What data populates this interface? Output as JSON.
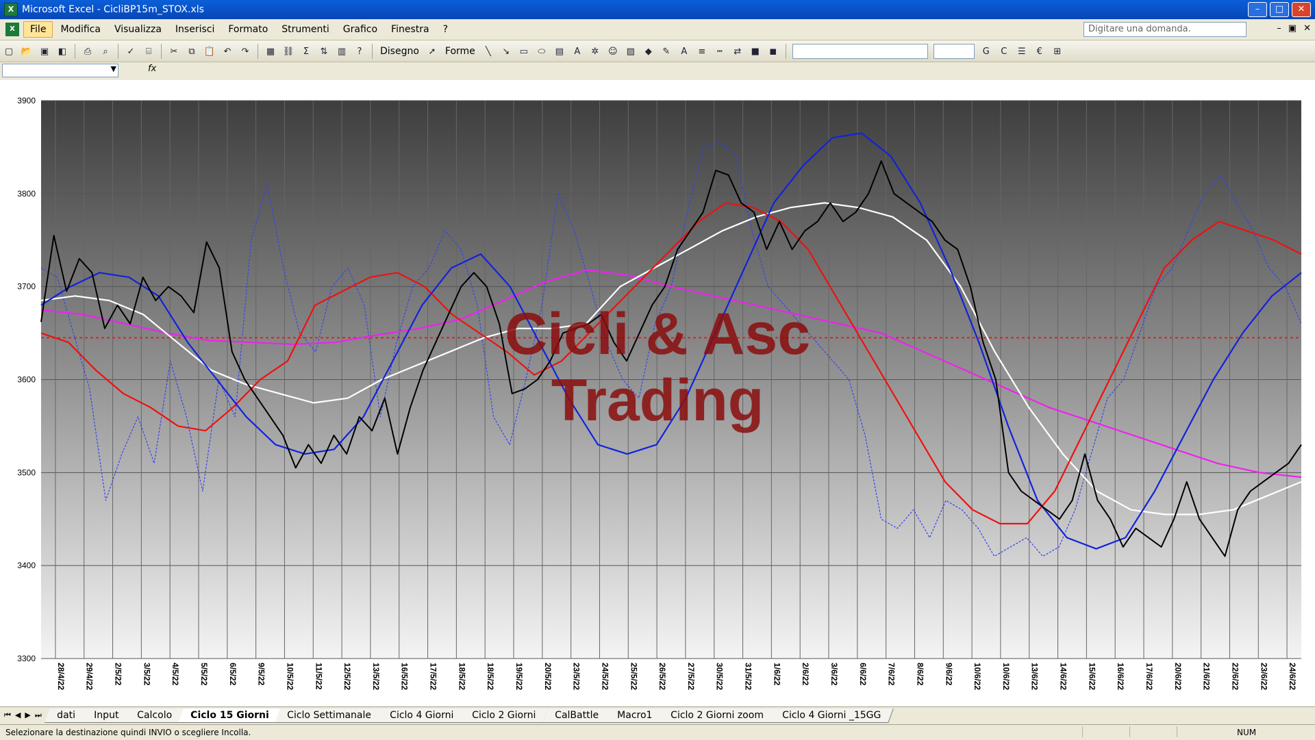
{
  "app": {
    "title": "Microsoft Excel - CicliBP15m_STOX.xls"
  },
  "window_controls": {
    "minimize": "–",
    "maximize": "□",
    "close": "✕"
  },
  "menu": [
    "File",
    "Modifica",
    "Visualizza",
    "Inserisci",
    "Formato",
    "Strumenti",
    "Grafico",
    "Finestra",
    "?"
  ],
  "help_box": {
    "placeholder": "Digitare una domanda."
  },
  "doc_controls": {
    "minimize": "–",
    "restore": "▣",
    "close": "✕"
  },
  "toolbar": {
    "disegno_label": "Disegno",
    "forme_label": "Forme",
    "icons": [
      "new-icon",
      "open-icon",
      "save-icon",
      "permission-icon",
      "print-icon",
      "print-preview-icon",
      "spelling-icon",
      "research-icon",
      "cut-icon",
      "copy-icon",
      "paste-icon",
      "undo-icon",
      "redo-icon",
      "chart-wizard-icon",
      "hyperlink-icon",
      "autosum-icon",
      "sort-icon",
      "chart-icon",
      "help-icon",
      "pointer-icon",
      "line-icon",
      "arrow-icon",
      "rectangle-icon",
      "oval-icon",
      "textbox-icon",
      "wordart-icon",
      "diagram-icon",
      "clipart-icon",
      "picture-icon",
      "fill-color-icon",
      "line-color-icon",
      "font-color-icon",
      "line-style-icon",
      "dash-style-icon",
      "arrow-style-icon",
      "shadow-icon",
      "3d-icon",
      "bold-icon",
      "italic-icon",
      "align-icon",
      "euro-icon",
      "borders-icon"
    ]
  },
  "formula_bar": {
    "fx": "fx"
  },
  "chart_data": {
    "type": "line",
    "ylim": [
      3300,
      3900
    ],
    "yticks": [
      "3900",
      "3800",
      "3700",
      "3600",
      "3500",
      "3400",
      "3300"
    ],
    "reference_line": 3645,
    "watermark": [
      "Cicli & Asc",
      "Trading"
    ],
    "x_labels": [
      "28/4/22",
      "29/4/22",
      "2/5/22",
      "3/5/22",
      "4/5/22",
      "5/5/22",
      "6/5/22",
      "9/5/22",
      "10/5/22",
      "11/5/22",
      "12/5/22",
      "13/5/22",
      "16/5/22",
      "17/5/22",
      "18/5/22",
      "18/5/22",
      "19/5/22",
      "20/5/22",
      "23/5/22",
      "24/5/22",
      "25/5/22",
      "26/5/22",
      "27/5/22",
      "30/5/22",
      "31/5/22",
      "1/6/22",
      "2/6/22",
      "3/6/22",
      "6/6/22",
      "7/6/22",
      "8/6/22",
      "9/6/22",
      "10/6/22",
      "10/6/22",
      "13/6/22",
      "14/6/22",
      "15/6/22",
      "16/6/22",
      "17/6/22",
      "20/6/22",
      "21/6/22",
      "22/6/22",
      "23/6/22",
      "24/6/22"
    ],
    "colors": {
      "price": "#000000",
      "cycle_fast": "#3344ee",
      "red_ma": "#ee1111",
      "blue_ma": "#1122dd",
      "white_ma": "#ffffff",
      "magenta_ma": "#ee22ee",
      "ref": "#dd2222",
      "watermark": "#8b0d0d"
    },
    "series": [
      {
        "key": "price",
        "values": [
          3662,
          3755,
          3695,
          3730,
          3715,
          3655,
          3680,
          3660,
          3710,
          3685,
          3700,
          3690,
          3672,
          3748,
          3720,
          3630,
          3600,
          3580,
          3560,
          3540,
          3505,
          3530,
          3510,
          3540,
          3520,
          3560,
          3545,
          3580,
          3520,
          3570,
          3610,
          3640,
          3670,
          3700,
          3715,
          3700,
          3660,
          3585,
          3590,
          3600,
          3620,
          3650,
          3655,
          3660,
          3670,
          3640,
          3620,
          3650,
          3680,
          3700,
          3740,
          3760,
          3780,
          3825,
          3820,
          3790,
          3780,
          3740,
          3770,
          3740,
          3760,
          3770,
          3790,
          3770,
          3780,
          3800,
          3835,
          3800,
          3790,
          3780,
          3770,
          3750,
          3740,
          3700,
          3640,
          3600,
          3500,
          3480,
          3470,
          3460,
          3450,
          3470,
          3520,
          3470,
          3450,
          3420,
          3440,
          3430,
          3420,
          3450,
          3490,
          3450,
          3430,
          3410,
          3460,
          3480,
          3490,
          3500,
          3510,
          3530
        ]
      },
      {
        "key": "cycle_fast",
        "values": [
          3720,
          3710,
          3650,
          3590,
          3470,
          3520,
          3560,
          3510,
          3620,
          3560,
          3480,
          3600,
          3560,
          3750,
          3810,
          3720,
          3650,
          3630,
          3700,
          3720,
          3680,
          3560,
          3640,
          3700,
          3720,
          3760,
          3740,
          3680,
          3560,
          3530,
          3600,
          3680,
          3800,
          3760,
          3700,
          3640,
          3600,
          3580,
          3660,
          3700,
          3780,
          3850,
          3855,
          3840,
          3760,
          3700,
          3680,
          3660,
          3640,
          3620,
          3600,
          3540,
          3450,
          3440,
          3460,
          3430,
          3470,
          3460,
          3440,
          3410,
          3420,
          3430,
          3410,
          3420,
          3460,
          3520,
          3580,
          3600,
          3650,
          3700,
          3720,
          3760,
          3800,
          3820,
          3790,
          3760,
          3720,
          3700,
          3660
        ]
      },
      {
        "key": "red_ma",
        "values": [
          3650,
          3640,
          3610,
          3585,
          3570,
          3550,
          3545,
          3570,
          3600,
          3620,
          3680,
          3695,
          3710,
          3715,
          3700,
          3670,
          3650,
          3630,
          3605,
          3620,
          3650,
          3680,
          3710,
          3740,
          3770,
          3790,
          3785,
          3770,
          3740,
          3690,
          3640,
          3590,
          3540,
          3490,
          3460,
          3445,
          3445,
          3480,
          3540,
          3600,
          3660,
          3720,
          3750,
          3770,
          3760,
          3750,
          3735
        ]
      },
      {
        "key": "blue_ma",
        "values": [
          3680,
          3700,
          3715,
          3710,
          3690,
          3640,
          3600,
          3560,
          3530,
          3520,
          3525,
          3560,
          3620,
          3680,
          3720,
          3735,
          3700,
          3640,
          3580,
          3530,
          3520,
          3530,
          3580,
          3650,
          3720,
          3790,
          3830,
          3860,
          3865,
          3840,
          3790,
          3720,
          3640,
          3550,
          3470,
          3430,
          3418,
          3430,
          3480,
          3540,
          3600,
          3650,
          3690,
          3715
        ]
      },
      {
        "key": "white_ma",
        "values": [
          3685,
          3690,
          3685,
          3670,
          3640,
          3610,
          3595,
          3585,
          3575,
          3580,
          3600,
          3615,
          3630,
          3645,
          3655,
          3655,
          3660,
          3700,
          3720,
          3740,
          3760,
          3775,
          3785,
          3790,
          3785,
          3775,
          3750,
          3700,
          3630,
          3570,
          3520,
          3480,
          3460,
          3455,
          3455,
          3460,
          3475,
          3490
        ]
      },
      {
        "key": "magenta_ma",
        "values": [
          3675,
          3670,
          3660,
          3650,
          3642,
          3640,
          3638,
          3640,
          3648,
          3655,
          3665,
          3685,
          3705,
          3718,
          3712,
          3700,
          3690,
          3680,
          3670,
          3660,
          3650,
          3630,
          3610,
          3590,
          3570,
          3555,
          3540,
          3525,
          3510,
          3500,
          3495
        ]
      }
    ]
  },
  "sheet_tabs": [
    "dati",
    "Input",
    "Calcolo",
    "Ciclo 15 Giorni",
    "Ciclo Settimanale",
    "Ciclo 4 Giorni",
    "Ciclo 2 Giorni",
    "CalBattle",
    "Macro1",
    "Ciclo 2 Giorni zoom",
    "Ciclo 4 Giorni _15GG"
  ],
  "active_sheet": "Ciclo 15 Giorni",
  "status": {
    "message": "Selezionare la destinazione quindi INVIO o scegliere Incolla.",
    "num": "NUM"
  }
}
